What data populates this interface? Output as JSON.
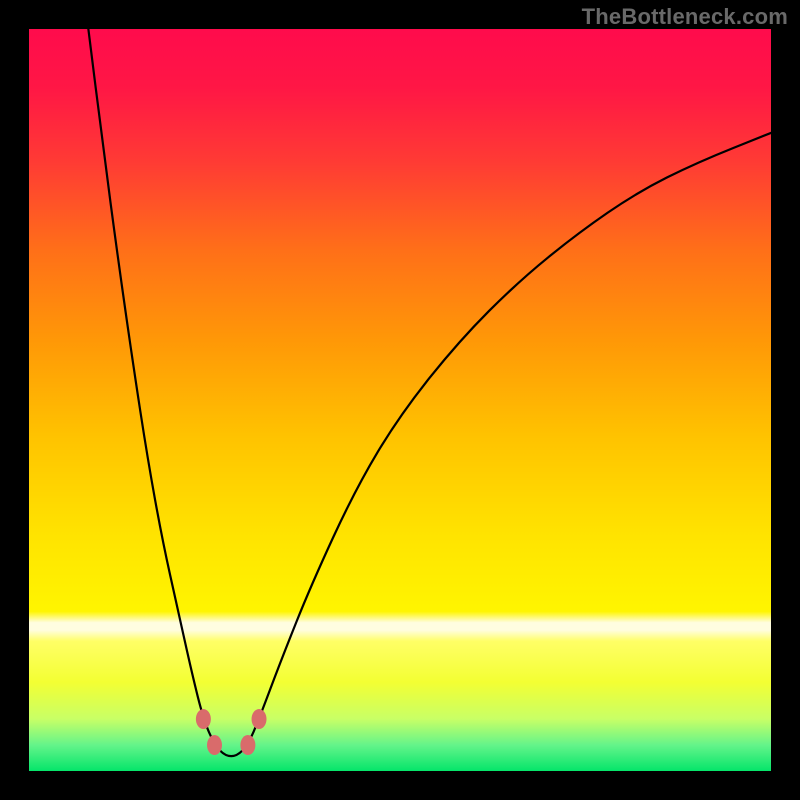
{
  "watermark": {
    "text": "TheBottleneck.com"
  },
  "colors": {
    "black": "#000000",
    "curve": "#000000",
    "marker": "#d96b6b",
    "watermark": "#696969"
  },
  "gradient_stops": [
    {
      "offset": 0.0,
      "color": "#ff0b4c"
    },
    {
      "offset": 0.08,
      "color": "#ff1745"
    },
    {
      "offset": 0.18,
      "color": "#ff3b34"
    },
    {
      "offset": 0.3,
      "color": "#ff7018"
    },
    {
      "offset": 0.42,
      "color": "#ff9807"
    },
    {
      "offset": 0.55,
      "color": "#ffc300"
    },
    {
      "offset": 0.68,
      "color": "#ffe300"
    },
    {
      "offset": 0.785,
      "color": "#fff500"
    },
    {
      "offset": 0.8,
      "color": "#fffde0"
    },
    {
      "offset": 0.81,
      "color": "#fffde0"
    },
    {
      "offset": 0.825,
      "color": "#ffff66"
    },
    {
      "offset": 0.88,
      "color": "#f3ff33"
    },
    {
      "offset": 0.93,
      "color": "#c8ff66"
    },
    {
      "offset": 0.965,
      "color": "#64f48a"
    },
    {
      "offset": 1.0,
      "color": "#05e56a"
    }
  ],
  "chart_data": {
    "type": "line",
    "title": "",
    "xlabel": "",
    "ylabel": "",
    "xlim": [
      0,
      100
    ],
    "ylim": [
      0,
      100
    ],
    "curve": [
      {
        "x": 8.0,
        "y": 100.0
      },
      {
        "x": 10.0,
        "y": 84.0
      },
      {
        "x": 12.0,
        "y": 69.0
      },
      {
        "x": 14.0,
        "y": 55.0
      },
      {
        "x": 16.0,
        "y": 42.0
      },
      {
        "x": 18.0,
        "y": 31.0
      },
      {
        "x": 20.0,
        "y": 22.0
      },
      {
        "x": 22.0,
        "y": 13.0
      },
      {
        "x": 23.5,
        "y": 7.0
      },
      {
        "x": 25.0,
        "y": 3.5
      },
      {
        "x": 26.5,
        "y": 2.0
      },
      {
        "x": 28.0,
        "y": 2.0
      },
      {
        "x": 29.5,
        "y": 3.5
      },
      {
        "x": 31.0,
        "y": 7.0
      },
      {
        "x": 34.0,
        "y": 15.0
      },
      {
        "x": 38.0,
        "y": 25.0
      },
      {
        "x": 44.0,
        "y": 38.0
      },
      {
        "x": 50.0,
        "y": 48.0
      },
      {
        "x": 58.0,
        "y": 58.0
      },
      {
        "x": 66.0,
        "y": 66.0
      },
      {
        "x": 74.0,
        "y": 72.5
      },
      {
        "x": 82.0,
        "y": 78.0
      },
      {
        "x": 90.0,
        "y": 82.0
      },
      {
        "x": 100.0,
        "y": 86.0
      }
    ],
    "markers": [
      {
        "x": 23.5,
        "y": 7.0
      },
      {
        "x": 25.0,
        "y": 3.5
      },
      {
        "x": 29.5,
        "y": 3.5
      },
      {
        "x": 31.0,
        "y": 7.0
      }
    ]
  }
}
